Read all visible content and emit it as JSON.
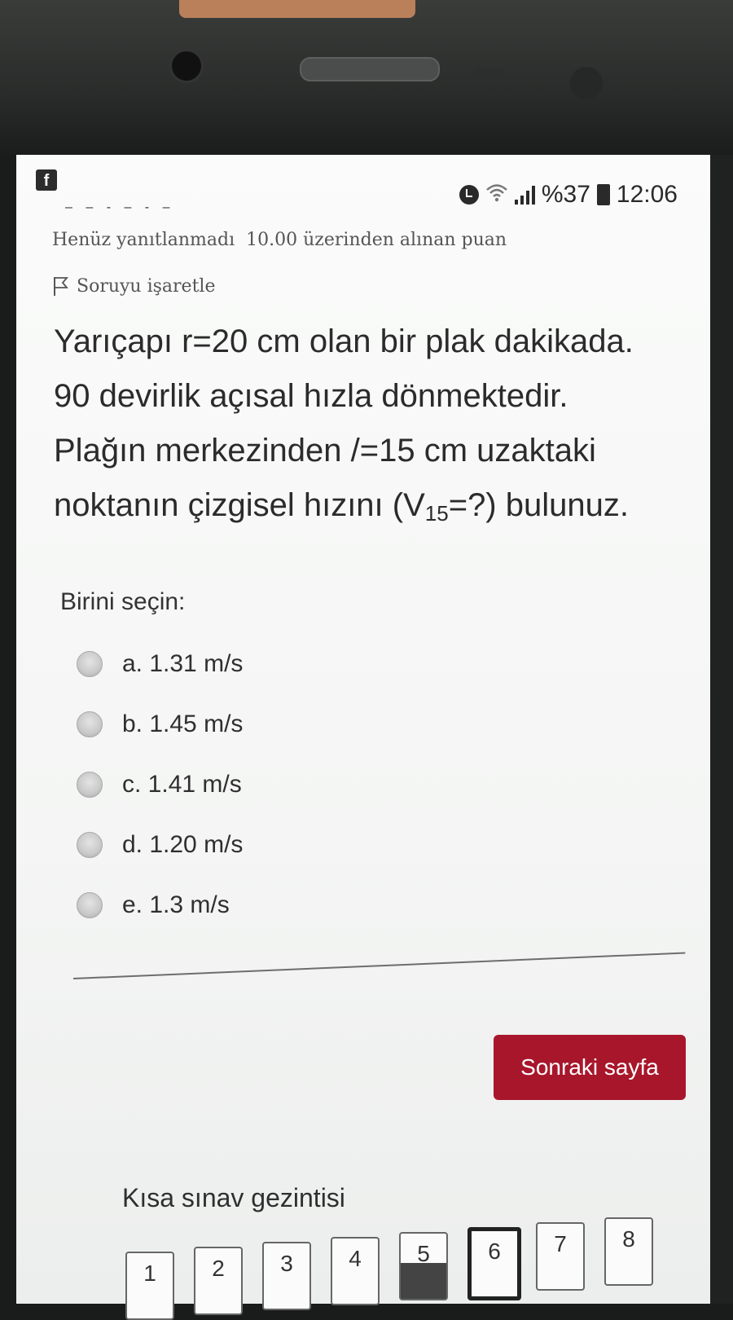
{
  "status_bar": {
    "app_icon": "f",
    "dashes": "– – - – -  –",
    "battery_percent": "%37",
    "time": "12:06"
  },
  "question_meta": {
    "state": "Henüz yanıtlanmadı",
    "points": "10.00 üzerinden alınan puan",
    "flag_label": "Soruyu işaretle"
  },
  "question": {
    "line1": "Yarıçapı r=20 cm olan bir plak dakikada.",
    "line2": "90 devirlik açısal hızla dönmektedir.",
    "line3": "Plağın merkezinden /=15 cm  uzaktaki",
    "line4_prefix": "noktanın çizgisel hızını (V",
    "line4_sub": "15",
    "line4_suffix": "=?) bulunuz."
  },
  "choose_label": "Birini seçin:",
  "answers": [
    {
      "label": "a. 1.31 m/s",
      "selected": false
    },
    {
      "label": "b. 1.45 m/s",
      "selected": false
    },
    {
      "label": "c. 1.41 m/s",
      "selected": false
    },
    {
      "label": "d. 1.20 m/s",
      "selected": false
    },
    {
      "label": "e. 1.3 m/s",
      "selected": false
    }
  ],
  "next_button": "Sonraki sayfa",
  "navigation": {
    "title": "Kısa sınav gezintisi",
    "items": [
      "1",
      "2",
      "3",
      "4",
      "5",
      "6",
      "7",
      "8"
    ],
    "current": "6"
  },
  "colors": {
    "accent": "#a8162b",
    "text": "#2b2b2b",
    "meta_text": "#555555"
  }
}
